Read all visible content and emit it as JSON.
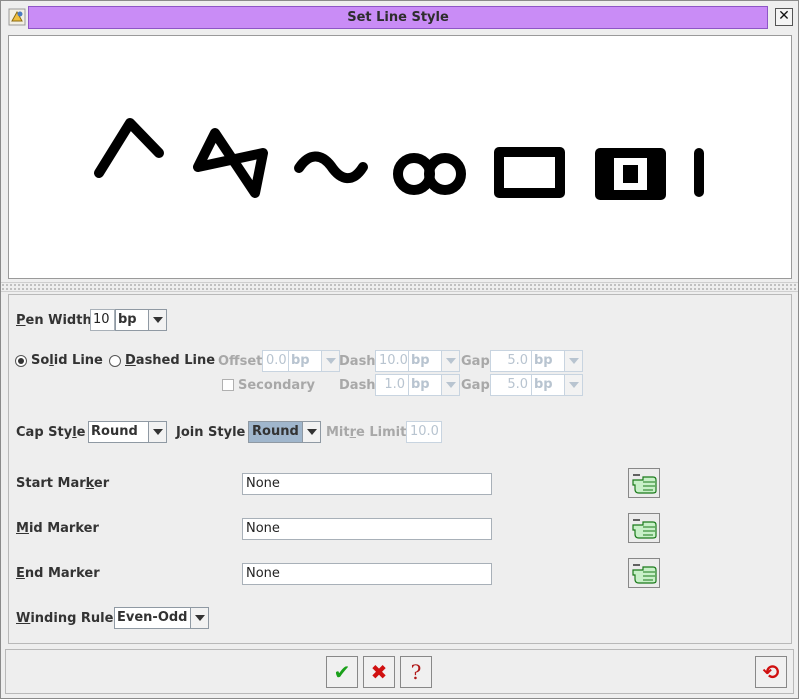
{
  "window": {
    "title": "Set Line Style"
  },
  "pen_width": {
    "label_u": "P",
    "label_rest": "en Width",
    "value": "10",
    "unit": "bp"
  },
  "line_type": {
    "solid_pre": "So",
    "solid_u": "l",
    "solid_rest": "id Line",
    "dashed_u": "D",
    "dashed_rest": "ashed Line",
    "selected": "solid"
  },
  "dash_primary": {
    "offset_label": "Offset",
    "offset_value": "0.0",
    "offset_unit": "bp",
    "dash_label": "Dash",
    "dash_value": "10.0",
    "dash_unit": "bp",
    "gap_label": "Gap",
    "gap_value": "5.0",
    "gap_unit": "bp"
  },
  "dash_secondary": {
    "secondary_label": "Secondary",
    "dash_label": "Dash",
    "dash_value": "1.0",
    "dash_unit": "bp",
    "gap_label": "Gap",
    "gap_value": "5.0",
    "gap_unit": "bp"
  },
  "cap_style": {
    "label_pre": "Cap Sty",
    "label_u": "l",
    "label_rest": "e",
    "value": "Round"
  },
  "join_style": {
    "label_u": "J",
    "label_rest": "oin Style",
    "value": "Round"
  },
  "mitre_limit": {
    "label_pre": "Mit",
    "label_u": "r",
    "label_rest": "e Limit",
    "value": "10.0"
  },
  "start_marker": {
    "label_pre": "Start Mar",
    "label_u": "k",
    "label_rest": "er",
    "value": "None"
  },
  "mid_marker": {
    "label_u": "M",
    "label_rest": "id Marker",
    "value": "None"
  },
  "end_marker": {
    "label_u": "E",
    "label_rest": "nd Marker",
    "value": "None"
  },
  "winding_rule": {
    "label_u": "W",
    "label_rest": "inding Rule",
    "value": "Even-Odd"
  },
  "buttons": {
    "ok": "✔",
    "cancel": "✖",
    "help": "?",
    "reset": "⟲"
  },
  "colors": {
    "title_bar": "#c98cf6",
    "ok_green": "#1aa01a",
    "cancel_red": "#d01010",
    "help_red": "#b01818",
    "reset_red": "#d01010"
  }
}
